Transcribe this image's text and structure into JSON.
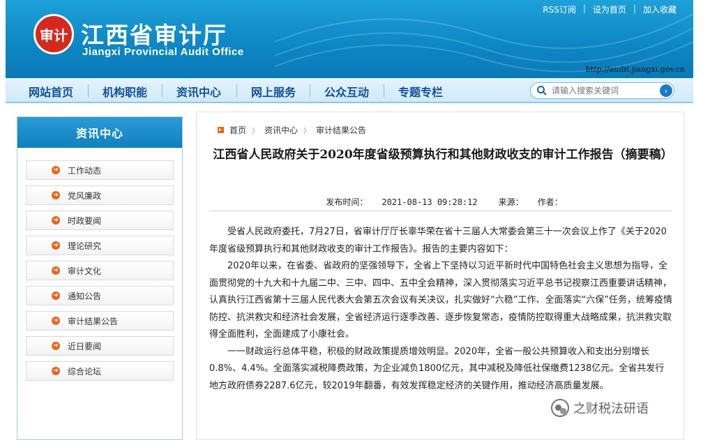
{
  "header": {
    "site_name_cn": "江西省审计厅",
    "site_name_en": "Jiangxi Provincial Audit Office",
    "seal_text": "审计",
    "top_links": [
      "RSS订阅",
      "设为首页",
      "加入收藏"
    ],
    "url": "http://audit.jiangxi.gov.cn"
  },
  "nav": {
    "items": [
      "网站首页",
      "机构职能",
      "资讯中心",
      "网上服务",
      "公众互动",
      "专题专栏"
    ],
    "search_placeholder": "请输入搜索关键词"
  },
  "sidebar": {
    "title": "资讯中心",
    "items": [
      "工作动态",
      "党风廉政",
      "时政要闻",
      "理论研究",
      "审计文化",
      "通知公告",
      "审计结果公告",
      "近日要闻",
      "综合论坛"
    ]
  },
  "breadcrumb": [
    "首页",
    "资讯中心",
    "审计结果公告"
  ],
  "article": {
    "title": "江西省人民政府关于2020年度省级预算执行和其他财政收支的审计工作报告（摘要稿）",
    "publish_label": "发布时间：",
    "publish_time": "2021-08-13 09:28:12",
    "source_label": "来源：",
    "author_label": "作者：",
    "paragraphs": [
      "受省人民政府委托，7月27日，省审计厅厅长辜华荣在省十三届人大常委会第三十一次会议上作了《关于2020年度省级预算执行和其他财政收支的审计工作报告》。报告的主要内容如下：",
      "2020年以来，在省委、省政府的坚强领导下，全省上下坚持以习近平新时代中国特色社会主义思想为指导，全面贯彻党的十九大和十九届二中、三中、四中、五中全会精神，深入贯彻落实习近平总书记视察江西重要讲话精神，认真执行江西省第十三届人民代表大会第五次会议有关决议，扎实做好“六稳”工作、全面落实“六保”任务，统筹疫情防控、抗洪救灾和经济社会发展，全省经济运行逐季改善、逐步恢复常态，疫情防控取得重大战略成果，抗洪救灾取得全面胜利，全面建成了小康社会。",
      "一一财政运行总体平稳，积极的财政政策提质增效明显。2020年，全省一般公共预算收入和支出分别增长0.8%、4.4%。全面落实减税降费政策，为企业减负1800亿元，其中减税及降低社保缴费1238亿元。全省共发行地方政府债券2287.6亿元，较2019年翻番，有效发挥稳定经济的关键作用，推动经济高质量发展。"
    ]
  },
  "watermark": "之财税法研语"
}
